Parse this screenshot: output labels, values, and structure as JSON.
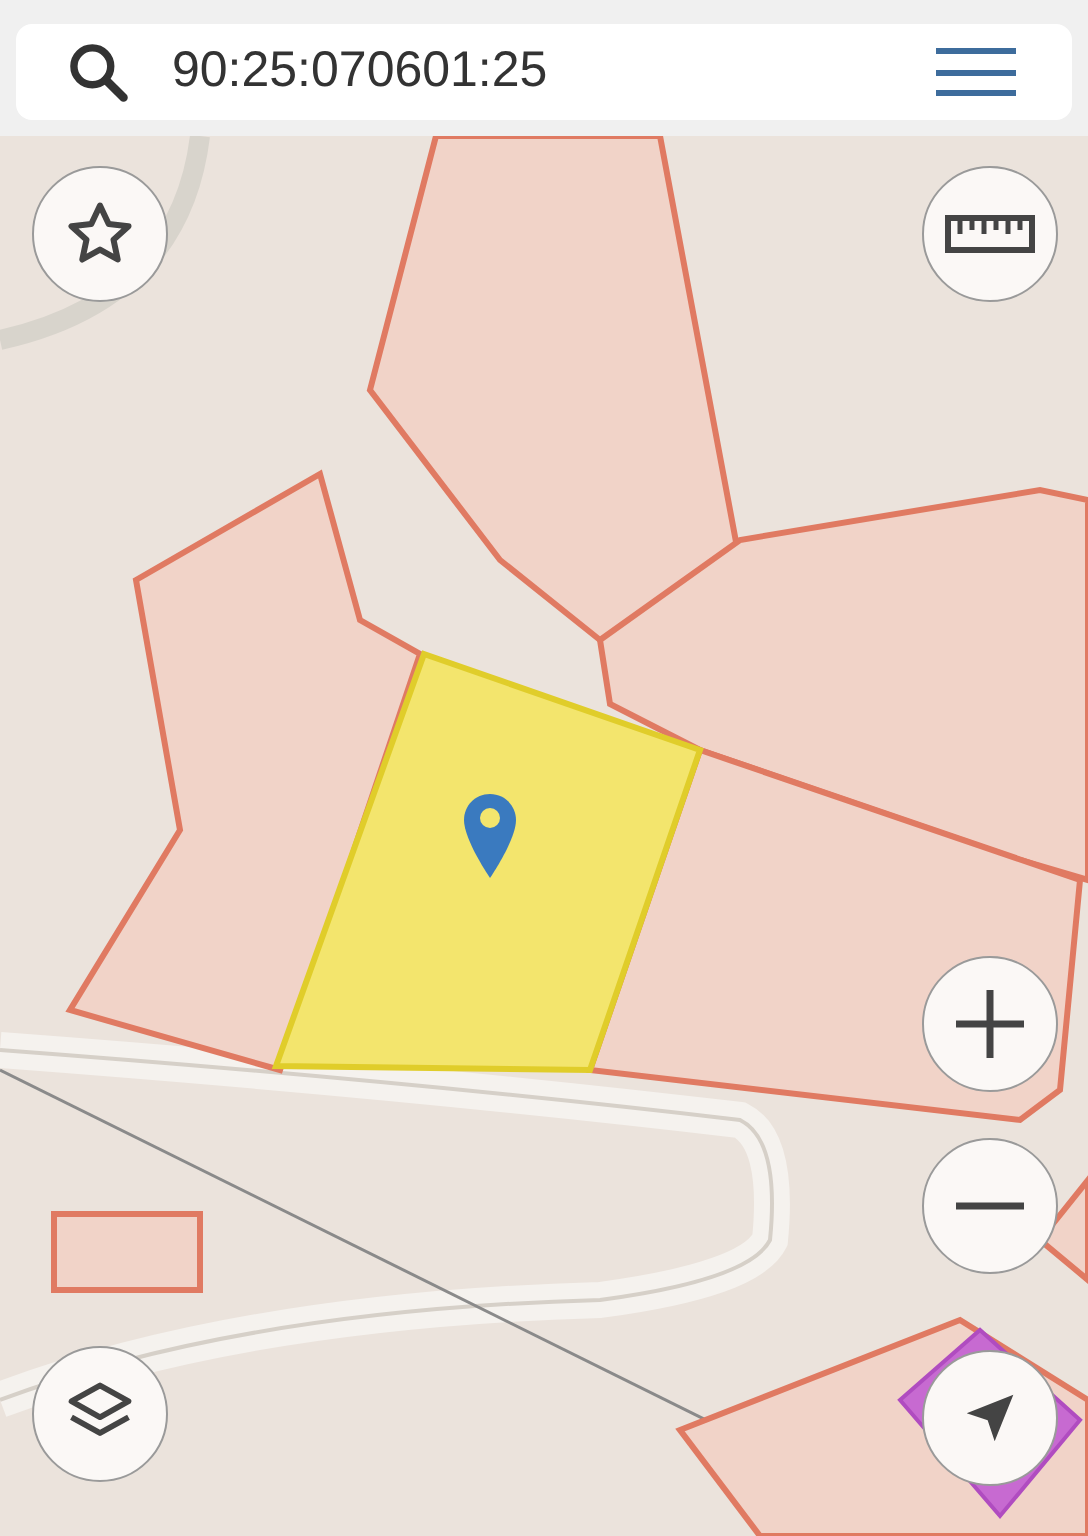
{
  "search": {
    "value": "90:25:070601:25"
  }
}
